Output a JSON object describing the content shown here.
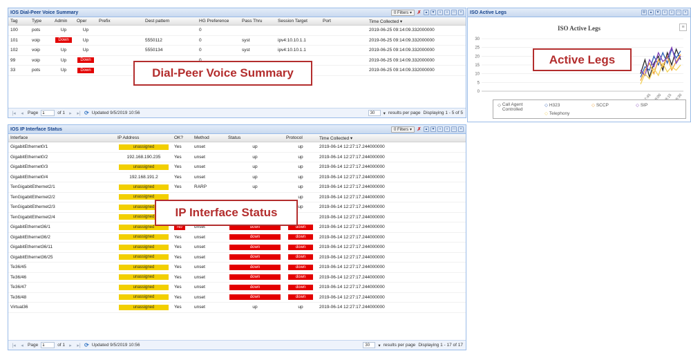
{
  "dialpeer": {
    "title": "IOS Dial-Peer Voice Summary",
    "filters": "0 Filters",
    "columns": [
      "Tag",
      "Type",
      "Admin",
      "Oper",
      "Prefix",
      "Dest pattern",
      "HG Preference",
      "Pass Thru",
      "Session Target",
      "Port",
      "Time Collected"
    ],
    "rows": [
      [
        "100",
        "pots",
        "Up",
        "Up",
        "",
        "",
        "0",
        "",
        "",
        "",
        "2019-06-25 09:14:09.332000000"
      ],
      [
        "101",
        "voip",
        "Down",
        "Up",
        "",
        "5550112",
        "0",
        "syst",
        "ipv4:10.10.1.1",
        "",
        "2019-06-25 09:14:09.332000000"
      ],
      [
        "102",
        "voip",
        "Up",
        "Up",
        "",
        "5550134",
        "0",
        "syst",
        "ipv4:10.10.1.1",
        "",
        "2019-06-25 09:14:09.332000000"
      ],
      [
        "99",
        "voip",
        "Up",
        "Down",
        "",
        "",
        "0",
        "",
        "",
        "",
        "2019-06-25 09:14:09.332000000"
      ],
      [
        "33",
        "pots",
        "Up",
        "Down",
        "",
        "",
        "0",
        "",
        "",
        "",
        "2019-06-25 09:14:09.332000000"
      ]
    ],
    "pager": {
      "page_label": "Page",
      "page": "1",
      "of": "of 1",
      "updated": "Updated 9/5/2019 10:56",
      "per_page": "30",
      "per_page_label": "results per page",
      "displaying": "Displaying 1 - 5 of 5"
    },
    "callout": "Dial-Peer Voice Summary"
  },
  "legs": {
    "title": "ISO Active Legs",
    "chart_title": "ISO Active Legs",
    "callout": "Active Legs",
    "legend": [
      "Call Agent Controlled",
      "H323",
      "SCCP",
      "SIP",
      "Telephony"
    ],
    "colors": {
      "call_agent": "#2a2a2a",
      "h323": "#2f5fb5",
      "sccp": "#f0a030",
      "sip": "#7d3fb7",
      "telephony": "#f2d25a"
    }
  },
  "chart_data": {
    "type": "line",
    "title": "ISO Active Legs",
    "ylim": [
      0,
      30
    ],
    "y_ticks": [
      "0",
      "5",
      "10",
      "15",
      "20",
      "25",
      "30"
    ],
    "x_ticks": [
      "07:45",
      "08:00",
      "08:15",
      "08:30"
    ],
    "series": [
      {
        "name": "Call Agent Controlled",
        "values": [
          10,
          18,
          8,
          16,
          20,
          12,
          22,
          15,
          24,
          18
        ]
      },
      {
        "name": "H323",
        "values": [
          8,
          14,
          12,
          20,
          15,
          22,
          16,
          24,
          19,
          23
        ]
      },
      {
        "name": "SCCP",
        "values": [
          6,
          12,
          16,
          10,
          18,
          14,
          20,
          12,
          17,
          21
        ]
      },
      {
        "name": "SIP",
        "values": [
          12,
          9,
          18,
          14,
          22,
          17,
          19,
          25,
          16,
          20
        ]
      },
      {
        "name": "Telephony",
        "values": [
          4,
          10,
          7,
          13,
          9,
          16,
          11,
          14,
          12,
          15
        ]
      }
    ]
  },
  "ipif": {
    "title": "IOS IP Interface Status",
    "filters": "0 Filters",
    "columns": [
      "Interface",
      "IP Address",
      "OK?",
      "Method",
      "Status",
      "Protocol",
      "Time Collected"
    ],
    "rows": [
      [
        "GigabitEthernet0/1",
        "unassigned",
        "Yes",
        "unset",
        "up",
        "up",
        "2019-06-14 12:27:17.244000000"
      ],
      [
        "GigabitEthernet0/2",
        "192.168.190.235",
        "Yes",
        "unset",
        "up",
        "up",
        "2019-06-14 12:27:17.244000000"
      ],
      [
        "GigabitEthernet0/3",
        "unassigned",
        "Yes",
        "unset",
        "up",
        "up",
        "2019-06-14 12:27:17.244000000"
      ],
      [
        "GigabitEthernet0/4",
        "192.168.191.2",
        "Yes",
        "unset",
        "up",
        "up",
        "2019-06-14 12:27:17.244000000"
      ],
      [
        "TenGigabitEthernet2/1",
        "unassigned",
        "Yes",
        "RARP",
        "up",
        "up",
        "2019-06-14 12:27:17.244000000"
      ],
      [
        "TenGigabitEthernet2/2",
        "unassigned",
        "",
        "",
        "",
        "up",
        "2019-06-14 12:27:17.244000000"
      ],
      [
        "TenGigabitEthernet2/3",
        "unassigned",
        "",
        "",
        "",
        "up",
        "2019-06-14 12:27:17.244000000"
      ],
      [
        "TenGigabitEthernet2/4",
        "unassigned",
        "",
        "",
        "",
        "",
        "2019-06-14 12:27:17.244000000"
      ],
      [
        "GigabitEthernet36/1",
        "unassigned",
        "No",
        "unset",
        "down",
        "down",
        "2019-06-14 12:27:17.244000000"
      ],
      [
        "GigabitEthernet36/2",
        "unassigned",
        "Yes",
        "unset",
        "down",
        "down",
        "2019-06-14 12:27:17.244000000"
      ],
      [
        "GigabitEthernet36/11",
        "unassigned",
        "Yes",
        "unset",
        "down",
        "down",
        "2019-06-14 12:27:17.244000000"
      ],
      [
        "GigabitEthernet36/25",
        "unassigned",
        "Yes",
        "unset",
        "down",
        "down",
        "2019-06-14 12:27:17.244000000"
      ],
      [
        "Te36/45",
        "unassigned",
        "Yes",
        "unset",
        "down",
        "down",
        "2019-06-14 12:27:17.244000000"
      ],
      [
        "Te36/46",
        "unassigned",
        "Yes",
        "unset",
        "down",
        "down",
        "2019-06-14 12:27:17.244000000"
      ],
      [
        "Te36/47",
        "unassigned",
        "Yes",
        "unset",
        "down",
        "down",
        "2019-06-14 12:27:17.244000000"
      ],
      [
        "Te36/48",
        "unassigned",
        "Yes",
        "unset",
        "down",
        "down",
        "2019-06-14 12:27:17.244000000"
      ],
      [
        "Virtual36",
        "unassigned",
        "Yes",
        "unset",
        "up",
        "up",
        "2019-06-14 12:27:17.244000000"
      ]
    ],
    "pager": {
      "page_label": "Page",
      "page": "1",
      "of": "of 1",
      "updated": "Updated 9/5/2019 10:56",
      "per_page": "30",
      "per_page_label": "results per page",
      "displaying": "Displaying 1 - 17 of 17"
    },
    "callout": "IP Interface Status"
  },
  "icons": {
    "clear_filters": "clear-filter-icon",
    "first": "first-page-icon",
    "prev": "prev-page-icon",
    "next": "next-page-icon",
    "last": "last-page-icon",
    "refresh": "refresh-icon"
  }
}
